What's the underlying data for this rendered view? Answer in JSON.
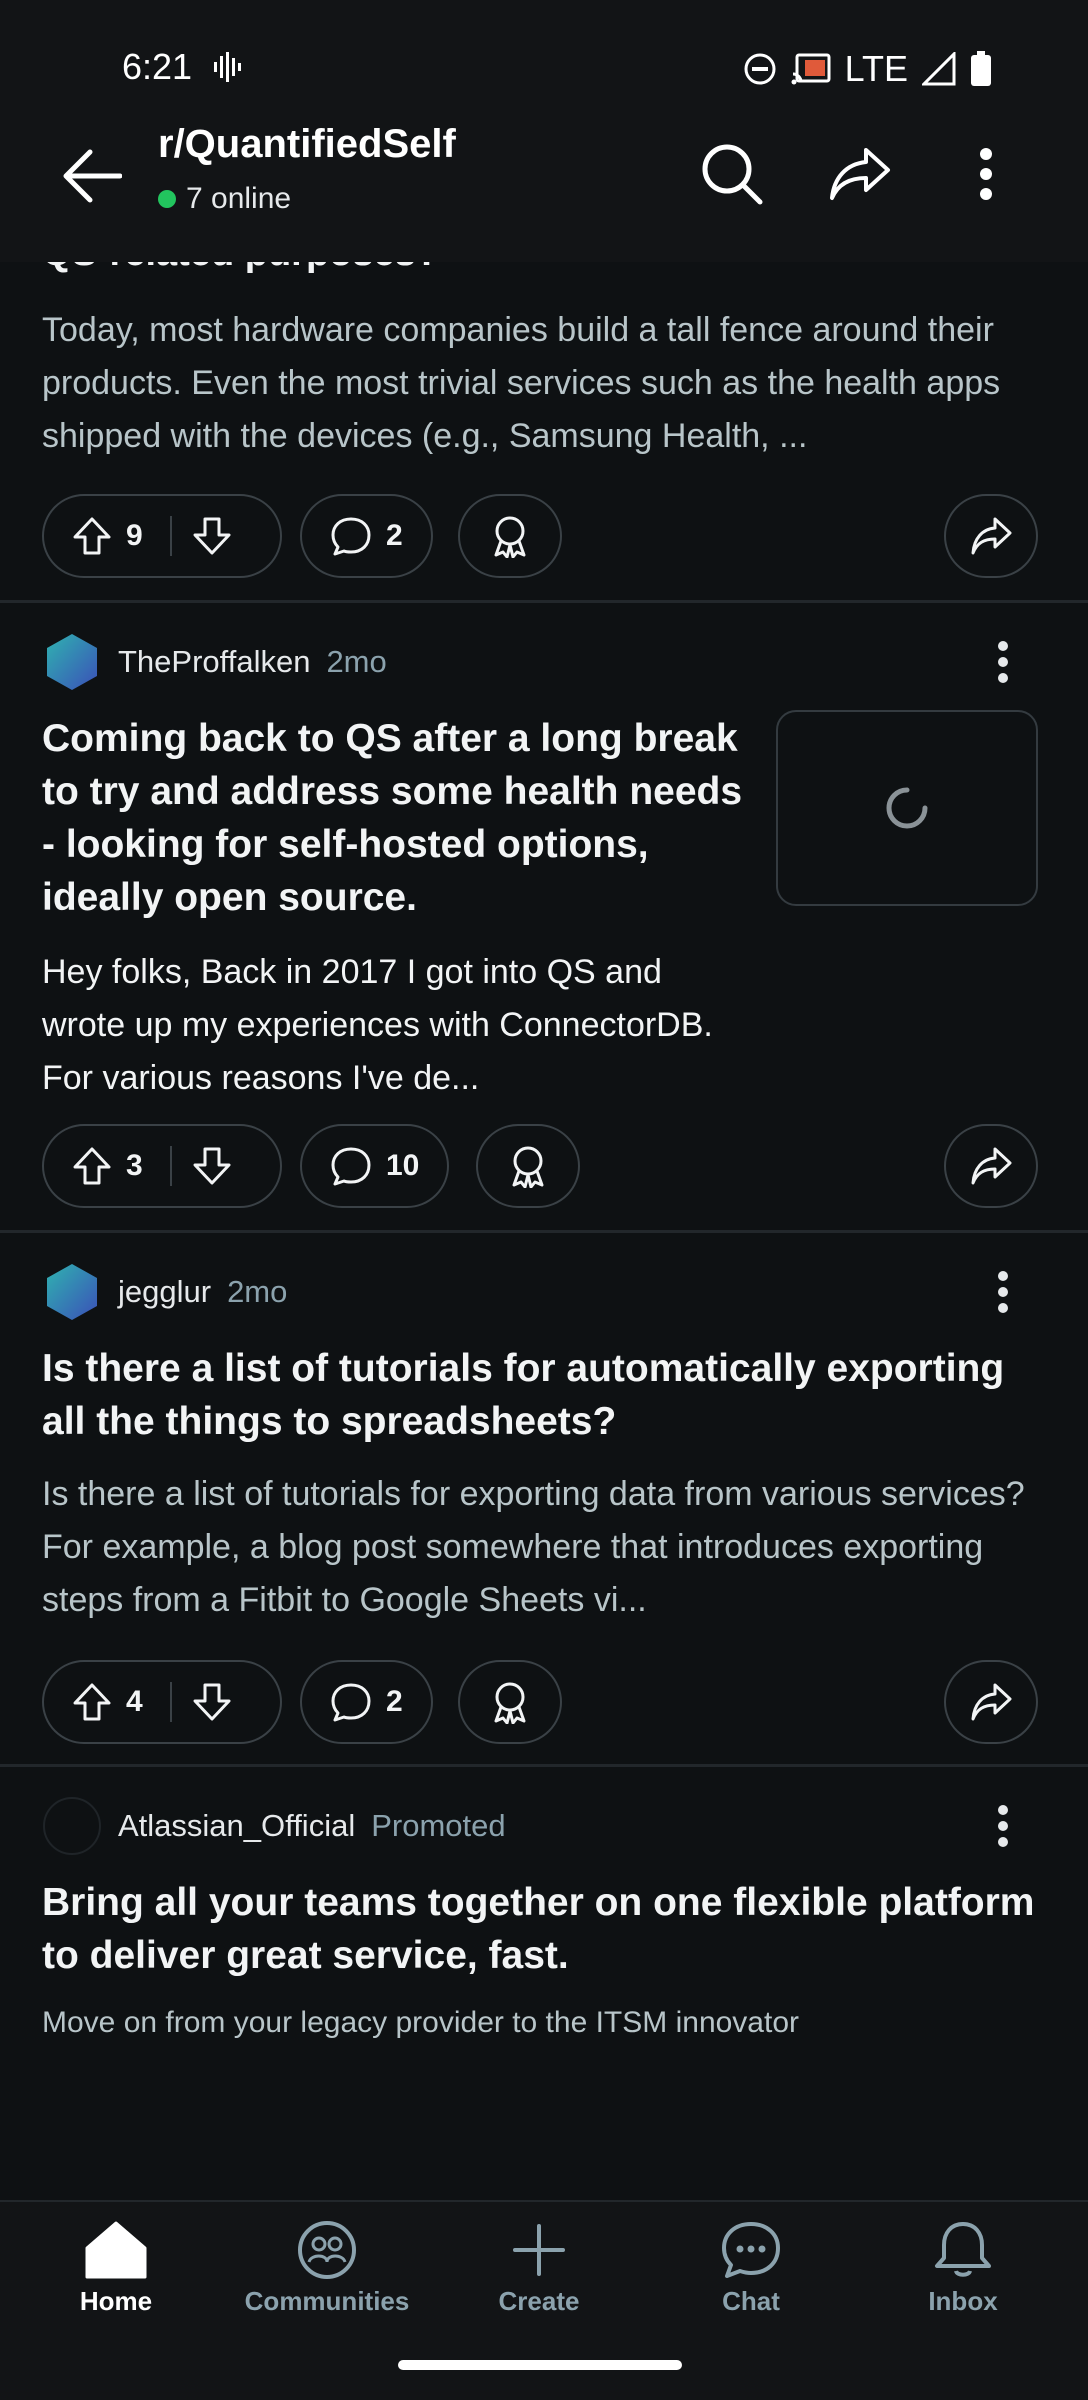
{
  "status": {
    "time": "6:21",
    "network": "LTE"
  },
  "header": {
    "subreddit": "r/QuantifiedSelf",
    "online": "7 online"
  },
  "posts": [
    {
      "title_partial": "QS-related purposes?",
      "body": "Today, most hardware companies build a tall fence around their products. Even the most trivial services such as the health apps shipped with the devices (e.g., Samsung Health, ...",
      "votes": "9",
      "comments": "2"
    },
    {
      "author": "TheProffalken",
      "age": "2mo",
      "title": "Coming back to QS after a long break to try and address some health needs - looking for self-hosted options, ideally open source.",
      "body": "Hey folks, Back in 2017 I got into QS and wrote up my experiences with ConnectorDB. For various reasons I've de...",
      "votes": "3",
      "comments": "10"
    },
    {
      "author": "jegglur",
      "age": "2mo",
      "title": "Is there a list of tutorials for automatically exporting all the things to spreadsheets?",
      "body": "Is there a list of tutorials for exporting data from various services? For example, a blog post somewhere that introduces exporting steps from a Fitbit to Google Sheets vi...",
      "votes": "4",
      "comments": "2"
    }
  ],
  "promoted": {
    "author": "Atlassian_Official",
    "tag": "Promoted",
    "title": "Bring all your teams together on one flexible platform to deliver great service, fast.",
    "body": "Move on from your legacy provider to the ITSM innovator"
  },
  "nav": [
    {
      "label": "Home",
      "icon": "home-icon",
      "active": true
    },
    {
      "label": "Communities",
      "icon": "communities-icon",
      "active": false
    },
    {
      "label": "Create",
      "icon": "plus-icon",
      "active": false
    },
    {
      "label": "Chat",
      "icon": "chat-icon",
      "active": false
    },
    {
      "label": "Inbox",
      "icon": "bell-icon",
      "active": false
    }
  ],
  "colors": {
    "background": "#0e1113",
    "online": "#22c55e",
    "muted": "#8ba2ad"
  }
}
